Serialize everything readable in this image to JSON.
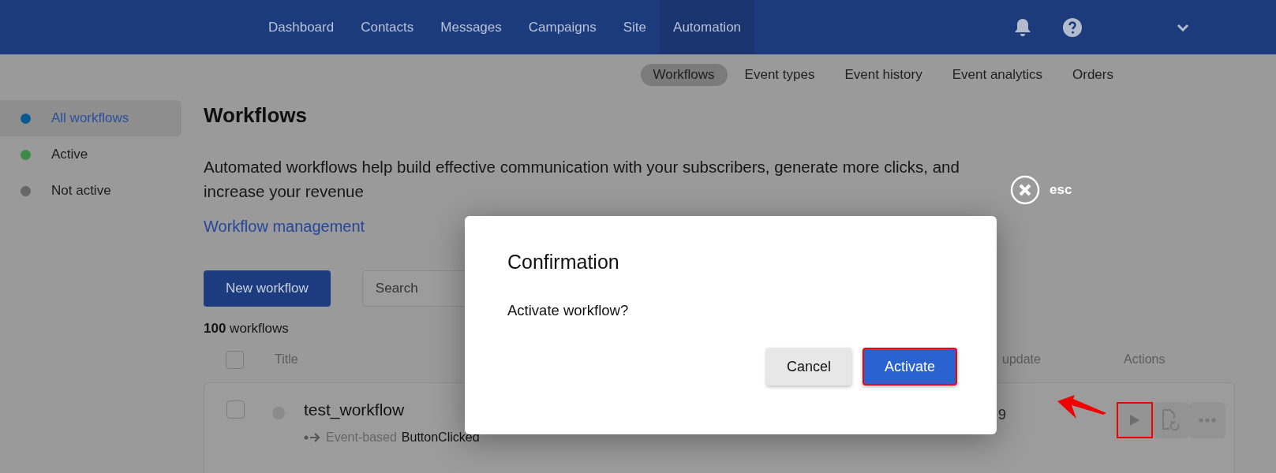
{
  "topbar": {
    "nav": [
      {
        "label": "Dashboard",
        "selected": false
      },
      {
        "label": "Contacts",
        "selected": false
      },
      {
        "label": "Messages",
        "selected": false
      },
      {
        "label": "Campaigns",
        "selected": false
      },
      {
        "label": "Site",
        "selected": false
      },
      {
        "label": "Automation",
        "selected": true
      }
    ]
  },
  "subnav": [
    {
      "label": "Workflows",
      "selected": true
    },
    {
      "label": "Event types",
      "selected": false
    },
    {
      "label": "Event history",
      "selected": false
    },
    {
      "label": "Event analytics",
      "selected": false
    },
    {
      "label": "Orders",
      "selected": false
    }
  ],
  "sidebar": {
    "items": [
      {
        "label": "All workflows",
        "selected": true,
        "color": "#0b5a8f"
      },
      {
        "label": "Active",
        "selected": false,
        "color": "#3d8a4a"
      },
      {
        "label": "Not active",
        "selected": false,
        "color": "#666666"
      }
    ]
  },
  "page": {
    "title": "Workflows",
    "description": "Automated workflows help build effective communication with your subscribers, generate more clicks, and increase your revenue",
    "link": "Workflow management",
    "new_button": "New workflow",
    "search": {
      "placeholder": "Search"
    },
    "count": "100",
    "count_label": "workflows"
  },
  "table": {
    "header_checked": false,
    "columns": [
      "Title",
      "update",
      "Actions"
    ],
    "rows": [
      {
        "title": "test_workflow",
        "checked": false,
        "type": "Event-based",
        "event": "ButtonClicked",
        "date": "9",
        "actions": [
          {
            "kind": "play",
            "highlighted": true
          },
          {
            "kind": "restore",
            "highlighted": false
          },
          {
            "kind": "more",
            "highlighted": false
          }
        ]
      }
    ]
  },
  "dialog": {
    "title": "Confirmation",
    "message": "Activate workflow?",
    "close_label": "esc",
    "buttons": [
      {
        "label": "Cancel",
        "kind": "secondary",
        "highlighted": false
      },
      {
        "label": "Activate",
        "kind": "primary",
        "highlighted": true
      }
    ]
  }
}
